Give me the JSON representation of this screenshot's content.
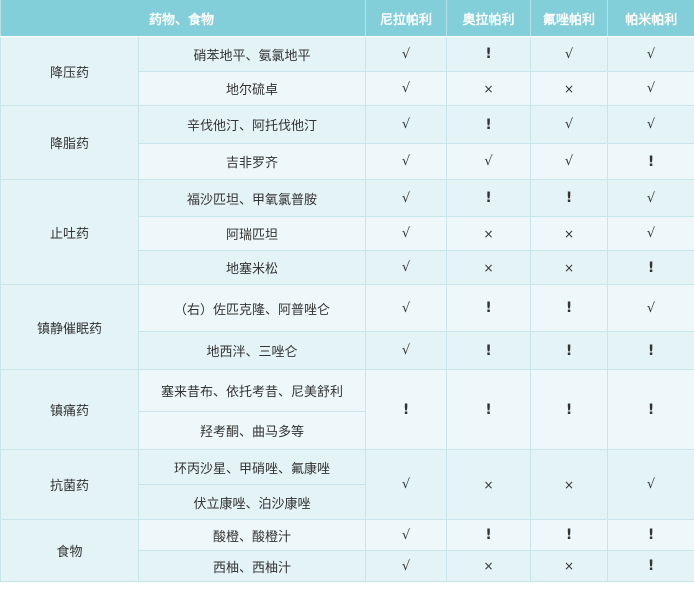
{
  "header": {
    "drug_food": "药物、食物",
    "col1": "尼拉帕利",
    "col2": "奥拉帕利",
    "col3": "氟唑帕利",
    "col4": "帕米帕利"
  },
  "categories": {
    "c0": "降压药",
    "c1": "降脂药",
    "c2": "止吐药",
    "c3": "镇静催眠药",
    "c4": "镇痛药",
    "c5": "抗菌药",
    "c6": "食物"
  },
  "rows": [
    {
      "drug": "硝苯地平、氨氯地平",
      "m": [
        "√",
        "!",
        "√",
        "√"
      ]
    },
    {
      "drug": "地尔硫卓",
      "m": [
        "√",
        "×",
        "×",
        "√"
      ]
    },
    {
      "drug": "辛伐他汀、阿托伐他汀",
      "m": [
        "√",
        "!",
        "√",
        "√"
      ]
    },
    {
      "drug": "吉非罗齐",
      "m": [
        "√",
        "√",
        "√",
        "!"
      ]
    },
    {
      "drug": "福沙匹坦、甲氧氯普胺",
      "m": [
        "√",
        "!",
        "!",
        "√"
      ]
    },
    {
      "drug": "阿瑞匹坦",
      "m": [
        "√",
        "×",
        "×",
        "√"
      ]
    },
    {
      "drug": "地塞米松",
      "m": [
        "√",
        "×",
        "×",
        "!"
      ]
    },
    {
      "drug": "（右）佐匹克隆、阿普唑仑",
      "m": [
        "√",
        "!",
        "!",
        "√"
      ]
    },
    {
      "drug": "地西泮、三唑仑",
      "m": [
        "√",
        "!",
        "!",
        "!"
      ]
    },
    {
      "drug": "塞来昔布、依托考昔、尼美舒利",
      "m": [
        "!",
        "!",
        "!",
        "!"
      ]
    },
    {
      "drug": "羟考酮、曲马多等"
    },
    {
      "drug": "环丙沙星、甲硝唑、氟康唑",
      "m": [
        "√",
        "×",
        "×",
        "√"
      ]
    },
    {
      "drug": "伏立康唑、泊沙康唑"
    },
    {
      "drug": "酸橙、酸橙汁",
      "m": [
        "√",
        "!",
        "!",
        "!"
      ]
    },
    {
      "drug": "西柚、西柚汁",
      "m": [
        "√",
        "×",
        "×",
        "!"
      ]
    }
  ]
}
